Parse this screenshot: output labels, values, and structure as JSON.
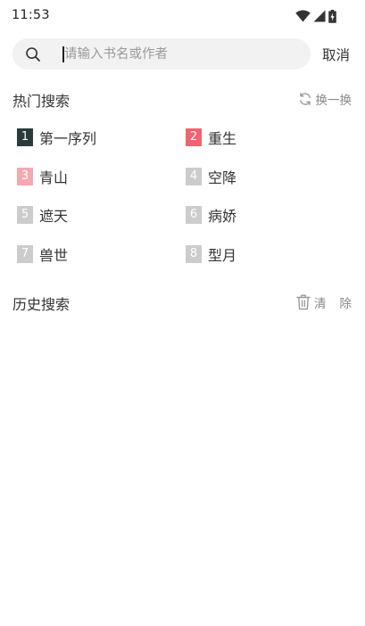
{
  "status_bar": {
    "time": "11:53",
    "icons": [
      "wifi-icon",
      "cellular-signal-icon",
      "battery-charging-icon"
    ]
  },
  "search": {
    "placeholder": "请输入书名或作者",
    "value": "",
    "cancel_label": "取消"
  },
  "hot_search": {
    "title": "热门搜索",
    "refresh_label": "换一换",
    "items": [
      {
        "rank": "1",
        "text": "第一序列",
        "rank_color": "#2b3a3a"
      },
      {
        "rank": "2",
        "text": "重生",
        "rank_color": "#f06470"
      },
      {
        "rank": "3",
        "text": "青山",
        "rank_color": "#f4a9b1"
      },
      {
        "rank": "4",
        "text": "空降",
        "rank_color": "#cccccc"
      },
      {
        "rank": "5",
        "text": "遮天",
        "rank_color": "#cccccc"
      },
      {
        "rank": "6",
        "text": "病娇",
        "rank_color": "#cccccc"
      },
      {
        "rank": "7",
        "text": "兽世",
        "rank_color": "#cccccc"
      },
      {
        "rank": "8",
        "text": "型月",
        "rank_color": "#cccccc"
      }
    ]
  },
  "history": {
    "title": "历史搜索",
    "clear_label": "清除"
  }
}
